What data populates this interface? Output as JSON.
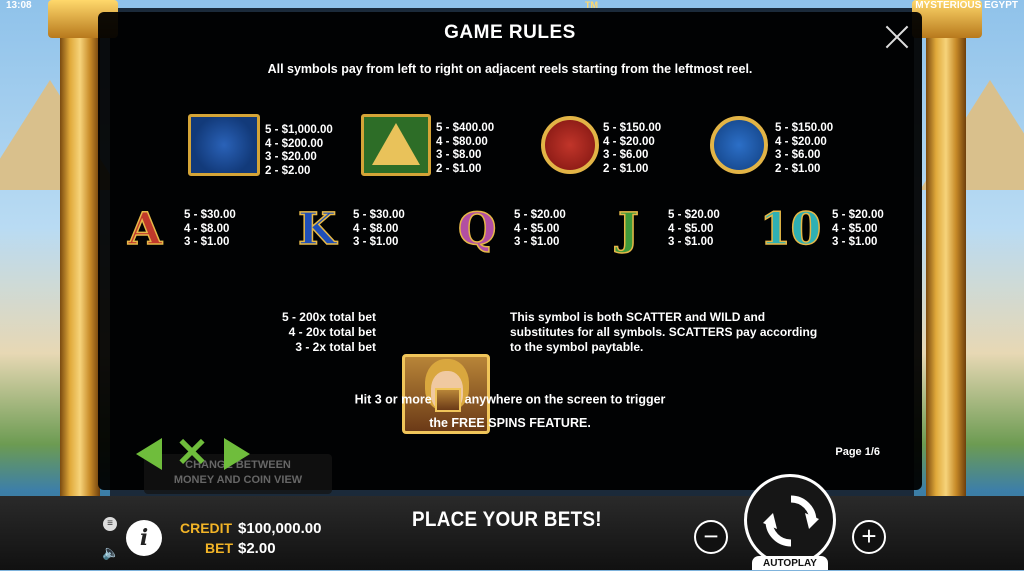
{
  "status": {
    "time": "13:08",
    "game_title": "MYSTERIOUS EGYPT",
    "tm": "TM"
  },
  "rules": {
    "title": "GAME RULES",
    "intro": "All symbols pay from left to right on adjacent reels starting from the leftmost reel.",
    "high_symbols": [
      {
        "icon": "eye-of-horus-icon",
        "pays": [
          "5 - $1,000.00",
          "4 - $200.00",
          "3 - $20.00",
          "2 - $2.00"
        ]
      },
      {
        "icon": "pyramid-icon",
        "pays": [
          "5 - $400.00",
          "4 - $80.00",
          "3 - $8.00",
          "2 - $1.00"
        ]
      },
      {
        "icon": "cat-coin-icon",
        "pays": [
          "5 - $150.00",
          "4 - $20.00",
          "3 - $6.00",
          "2 - $1.00"
        ]
      },
      {
        "icon": "falcon-coin-icon",
        "pays": [
          "5 - $150.00",
          "4 - $20.00",
          "3 - $6.00",
          "2 - $1.00"
        ]
      }
    ],
    "low_symbols": [
      {
        "letter": "A",
        "color": "#c0392b",
        "pays": [
          "5 - $30.00",
          "4 - $8.00",
          "3 - $1.00"
        ]
      },
      {
        "letter": "K",
        "color": "#1f4fb8",
        "pays": [
          "5 - $30.00",
          "4 - $8.00",
          "3 - $1.00"
        ]
      },
      {
        "letter": "Q",
        "color": "#b24fa3",
        "pays": [
          "5 - $20.00",
          "4 - $5.00",
          "3 - $1.00"
        ]
      },
      {
        "letter": "J",
        "color": "#3f9a3a",
        "pays": [
          "5 - $20.00",
          "4 - $5.00",
          "3 - $1.00"
        ]
      },
      {
        "letter": "10",
        "color": "#2fb0b3",
        "pays": [
          "5 - $20.00",
          "4 - $5.00",
          "3 - $1.00"
        ]
      }
    ],
    "scatter": {
      "pays": [
        "5 - 200x total bet",
        "4 - 20x total bet",
        "3 - 2x total bet"
      ],
      "description": "This symbol is both SCATTER and WILD and substitutes for all symbols. SCATTERS pay according to the symbol paytable.",
      "trigger_before": "Hit 3 or more",
      "trigger_after": "anywhere on the screen to trigger",
      "trigger_line2": "the FREE SPINS FEATURE."
    },
    "page": "Page 1/6"
  },
  "tooltip": {
    "line1": "CHANGE BETWEEN",
    "line2": "MONEY AND COIN VIEW"
  },
  "bottom": {
    "credit_label": "CREDIT",
    "credit_value": "$100,000.00",
    "bet_label": "BET",
    "bet_value": "$2.00",
    "message": "PLACE YOUR BETS!",
    "autoplay_label": "AUTOPLAY",
    "info_label": "i",
    "minus_label": "−",
    "plus_label": "+"
  },
  "colors": {
    "accent": "#f2b427",
    "arrow_green": "#6fbd3c"
  }
}
